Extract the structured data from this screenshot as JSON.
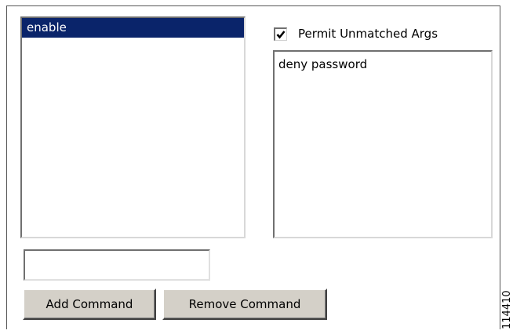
{
  "command_list": {
    "items": [
      {
        "label": "enable",
        "selected": true
      }
    ]
  },
  "permit_unmatched": {
    "label": "Permit Unmatched Args",
    "checked": true
  },
  "argument_list": {
    "items": [
      {
        "label": "deny password"
      }
    ]
  },
  "command_input": {
    "value": "",
    "placeholder": ""
  },
  "buttons": {
    "add_label": "Add Command",
    "remove_label": "Remove Command"
  },
  "figure_id": "114410",
  "colors": {
    "selection": "#0a246a",
    "button_face": "#d4d0c8"
  }
}
